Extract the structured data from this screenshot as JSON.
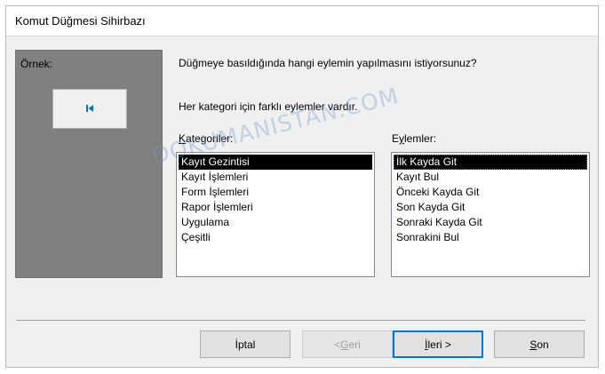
{
  "window": {
    "title": "Komut Düğmesi Sihirbazı"
  },
  "preview": {
    "label": "Örnek:",
    "sample_icon": "first-record-icon"
  },
  "question": "Düğmeye basıldığında hangi eylemin yapılmasını istiyorsunuz?",
  "info": "Her kategori için farklı eylemler vardır.",
  "categories": {
    "label": "Kategoriler:",
    "items": [
      "Kayıt Gezintisi",
      "Kayıt İşlemleri",
      "Form İşlemleri",
      "Rapor İşlemleri",
      "Uygulama",
      "Çeşitli"
    ],
    "selected": "Kayıt Gezintisi"
  },
  "actions": {
    "label": "Eylemler:",
    "items": [
      "İlk Kayda Git",
      "Kayıt Bul",
      "Önceki Kayda Git",
      "Son Kayda Git",
      "Sonraki Kayda Git",
      "Sonrakini Bul"
    ],
    "selected": "İlk Kayda Git"
  },
  "buttons": {
    "cancel": "İptal",
    "back": "< Geri",
    "next": "İleri >",
    "finish": "Son"
  },
  "watermark": "DOKUMANISTAN.COM",
  "colors": {
    "preview_bg": "#808080",
    "selection": "#000000",
    "accent": "#0078d7",
    "icon": "#1a6fb5"
  }
}
